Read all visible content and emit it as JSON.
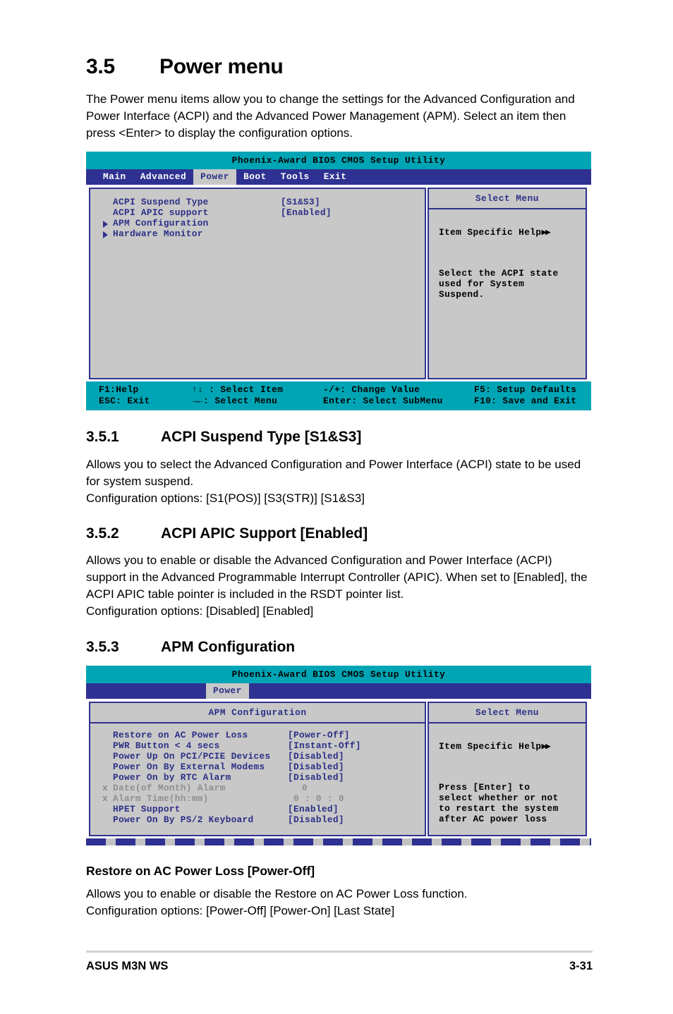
{
  "document": {
    "section": {
      "number": "3.5",
      "title": "Power menu"
    },
    "intro": "The Power menu items allow you to change the settings for the Advanced Configuration and Power Interface (ACPI) and the Advanced Power Management (APM). Select an item then press <Enter> to display the configuration options.",
    "subsections": [
      {
        "number": "3.5.1",
        "title": "ACPI Suspend Type [S1&S3]",
        "paragraph": "Allows you to select the Advanced Configuration and Power Interface (ACPI) state to be used for system suspend.",
        "options": "Configuration options: [S1(POS)] [S3(STR)] [S1&S3]"
      },
      {
        "number": "3.5.2",
        "title": "ACPI APIC Support [Enabled]",
        "paragraph": "Allows you to enable or disable the Advanced Configuration and Power Interface (ACPI) support in the Advanced Programmable Interrupt Controller (APIC). When set to [Enabled], the ACPI APIC table pointer is included in the RSDT pointer list.",
        "options": "Configuration options: [Disabled] [Enabled]"
      },
      {
        "number": "3.5.3",
        "title": "APM Configuration"
      }
    ],
    "item_heading": "Restore on AC Power Loss [Power-Off]",
    "item_paragraph": "Allows you to enable or disable the Restore on AC Power Loss function.",
    "item_options": "Configuration options: [Power-Off] [Power-On] [Last State]",
    "footer": {
      "left": "ASUS M3N WS",
      "right": "3-31"
    }
  },
  "bios1": {
    "title": "Phoenix-Award BIOS CMOS Setup Utility",
    "tabs": [
      {
        "label": "Main",
        "active": false
      },
      {
        "label": "Advanced",
        "active": false
      },
      {
        "label": "Power",
        "active": true
      },
      {
        "label": "Boot",
        "active": false
      },
      {
        "label": "Tools",
        "active": false
      },
      {
        "label": "Exit",
        "active": false
      }
    ],
    "items": [
      {
        "mark": "",
        "label": "ACPI Suspend Type",
        "value": "[S1&S3]",
        "submenu": false,
        "dim": false
      },
      {
        "mark": "",
        "label": "ACPI APIC support",
        "value": "[Enabled]",
        "submenu": false,
        "dim": false
      },
      {
        "mark": "",
        "label": "APM Configuration",
        "value": "",
        "submenu": true,
        "dim": false
      },
      {
        "mark": "",
        "label": "Hardware Monitor",
        "value": "",
        "submenu": true,
        "dim": false
      }
    ],
    "help_panel_title": "Select Menu",
    "help_title": "Item Specific Help",
    "help_text": "Select the ACPI state\nused for System\nSuspend.",
    "footer": [
      {
        "c1": "F1:Help",
        "c2": "↑↓ : Select Item",
        "c3": "-/+: Change Value",
        "c4": "F5: Setup Defaults"
      },
      {
        "c1": "ESC: Exit",
        "c2": "→←: Select Menu",
        "c3": "Enter: Select SubMenu",
        "c4": "F10: Save and Exit"
      }
    ]
  },
  "bios2": {
    "title": "Phoenix-Award BIOS CMOS Setup Utility",
    "tabs": [
      {
        "label": "Power",
        "active": true
      }
    ],
    "panel_title": "APM Configuration",
    "items": [
      {
        "mark": "",
        "label": "Restore on AC Power Loss",
        "value": "[Power-Off]",
        "dim": false
      },
      {
        "mark": "",
        "label": "PWR Button < 4 secs",
        "value": "[Instant-Off]",
        "dim": false
      },
      {
        "mark": "",
        "label": "Power Up On PCI/PCIE Devices",
        "value": "[Disabled]",
        "dim": false
      },
      {
        "mark": "",
        "label": "Power On By External Modems",
        "value": "[Disabled]",
        "dim": false
      },
      {
        "mark": "",
        "label": "Power On by RTC Alarm",
        "value": "[Disabled]",
        "dim": false
      },
      {
        "mark": "x",
        "label": "Date(of Month) Alarm",
        "value": "0",
        "dim": true
      },
      {
        "mark": "x",
        "label": "Alarm Time(hh:mm)",
        "value": "0 : 0 : 0",
        "dim": true
      },
      {
        "mark": "",
        "label": "HPET Support",
        "value": "[Enabled]",
        "dim": false
      },
      {
        "mark": "",
        "label": "Power On By PS/2 Keyboard",
        "value": "[Disabled]",
        "dim": false
      }
    ],
    "help_panel_title": "Select Menu",
    "help_title": "Item Specific Help",
    "help_text": "Press [Enter] to\nselect whether or not\nto restart the system\nafter AC power loss"
  },
  "colors": {
    "bios_title_bg": "#00a5b5",
    "bios_tab_bg": "#2f3192",
    "bios_panel_bg": "#c8c8c8",
    "bios_text": "#2c2f86",
    "bios_dim_text": "#8f8f8f"
  }
}
